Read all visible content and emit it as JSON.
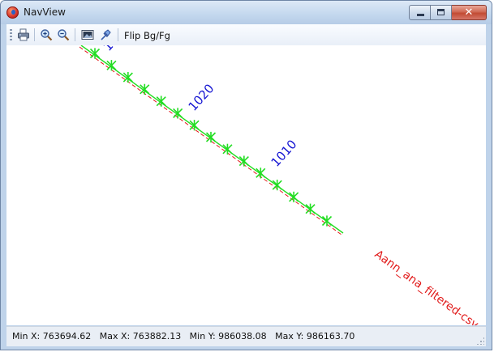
{
  "window": {
    "title": "NavView",
    "title_icon": "app-globe-icon",
    "caption_buttons": [
      "minimize",
      "maximize",
      "close"
    ]
  },
  "toolbar": {
    "buttons": [
      {
        "name": "print-icon",
        "tooltip": ""
      },
      {
        "name": "zoom-in-icon",
        "tooltip": ""
      },
      {
        "name": "zoom-out-icon",
        "tooltip": ""
      },
      {
        "name": "image-icon",
        "tooltip": ""
      },
      {
        "name": "pin-icon",
        "tooltip": ""
      }
    ],
    "flip_label": "Flip Bg/Fg"
  },
  "map": {
    "labels": [
      {
        "text": "1",
        "color": "#1414d2"
      },
      {
        "text": "1020",
        "color": "#1414d2"
      },
      {
        "text": "1010",
        "color": "#1414d2"
      },
      {
        "text": "Aann_ana_filtered-csv",
        "color": "#e11a1a"
      }
    ],
    "track_color": "#e11a1a",
    "line_color": "#22dd22",
    "marker_color": "#22dd22",
    "marker_count": 15
  },
  "status": {
    "text": "Min X: 763694.62   Max X: 763882.13   Min Y: 986038.08   Max Y: 986163.70"
  },
  "colors": {
    "titlebar": "#c3d7ee",
    "close_button": "#c24b33",
    "statusbar": "#e9eef5"
  }
}
